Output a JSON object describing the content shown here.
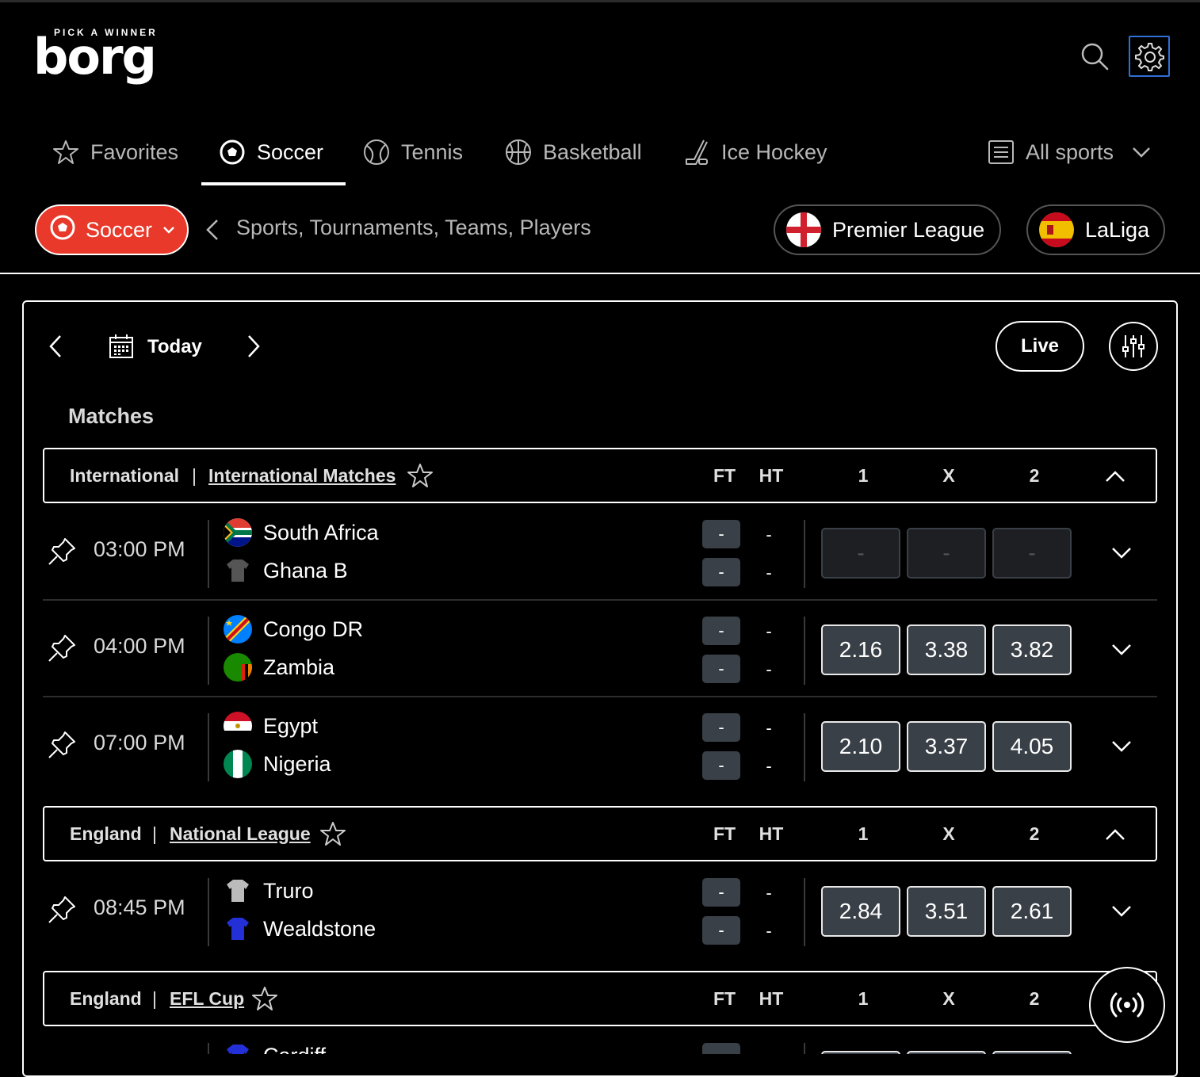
{
  "header": {
    "logo_tagline": "PICK A WINNER",
    "logo_word": "borg",
    "search_icon": "search-icon",
    "settings_icon": "gear-icon",
    "accent_color": "#2f6fd6"
  },
  "sport_tabs": [
    {
      "label": "Favorites",
      "icon": "star-icon",
      "active": false
    },
    {
      "label": "Soccer",
      "icon": "soccer-ball-icon",
      "active": true
    },
    {
      "label": "Tennis",
      "icon": "tennis-ball-icon",
      "active": false
    },
    {
      "label": "Basketball",
      "icon": "basketball-icon",
      "active": false
    },
    {
      "label": "Ice Hockey",
      "icon": "hockey-stick-icon",
      "active": false
    }
  ],
  "all_sports": {
    "label": "All sports",
    "icon": "list-icon"
  },
  "filter_bar": {
    "sport_pill": "Soccer",
    "sport_pill_color": "#e8392b",
    "search_hint": "Sports, Tournaments, Teams, Players",
    "quick_leagues": [
      {
        "label": "Premier League",
        "flag": "england-flag-icon"
      },
      {
        "label": "LaLiga",
        "flag": "spain-flag-icon"
      }
    ]
  },
  "date_nav": {
    "label": "Today"
  },
  "live_button": "Live",
  "matches_title": "Matches",
  "columns": {
    "ft": "FT",
    "ht": "HT",
    "c1": "1",
    "cx": "X",
    "c2": "2"
  },
  "leagues": [
    {
      "country": "International",
      "separator": "|",
      "name": "International Matches",
      "matches": [
        {
          "time": "03:00 PM",
          "home": "South Africa",
          "away": "Ghana B",
          "ft_home": "-",
          "ft_away": "-",
          "ht_home": "-",
          "ht_away": "-",
          "odds": [
            "-",
            "-",
            "-"
          ],
          "odds_available": false
        },
        {
          "time": "04:00 PM",
          "home": "Congo DR",
          "away": "Zambia",
          "ft_home": "-",
          "ft_away": "-",
          "ht_home": "-",
          "ht_away": "-",
          "odds": [
            "2.16",
            "3.38",
            "3.82"
          ],
          "odds_available": true
        },
        {
          "time": "07:00 PM",
          "home": "Egypt",
          "away": "Nigeria",
          "ft_home": "-",
          "ft_away": "-",
          "ht_home": "-",
          "ht_away": "-",
          "odds": [
            "2.10",
            "3.37",
            "4.05"
          ],
          "odds_available": true
        }
      ]
    },
    {
      "country": "England",
      "separator": "|",
      "name": "National League",
      "matches": [
        {
          "time": "08:45 PM",
          "home": "Truro",
          "away": "Wealdstone",
          "ft_home": "-",
          "ft_away": "-",
          "ht_home": "-",
          "ht_away": "-",
          "odds": [
            "2.84",
            "3.51",
            "2.61"
          ],
          "odds_available": true
        }
      ]
    },
    {
      "country": "England",
      "separator": "|",
      "name": "EFL Cup",
      "matches": [
        {
          "home": "Cardiff"
        }
      ]
    }
  ]
}
